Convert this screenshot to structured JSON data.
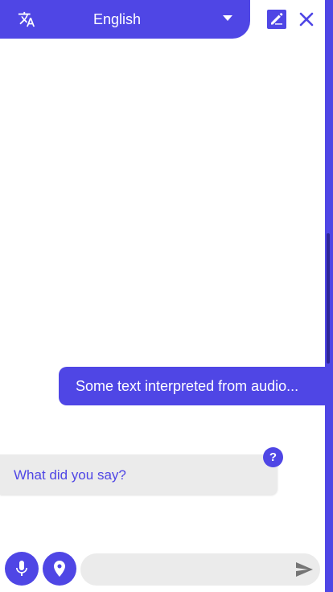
{
  "header": {
    "language_selected": "English",
    "icons": {
      "translate": "translate-icon",
      "caret": "chevron-down-icon",
      "edit": "edit-note-icon",
      "close": "close-icon"
    }
  },
  "messages": [
    {
      "from": "user",
      "text": "Some text interpreted from audio..."
    },
    {
      "from": "bot",
      "text": "What did you say?"
    }
  ],
  "help_badge": {
    "label": "?"
  },
  "composer": {
    "placeholder": "",
    "icons": {
      "mic": "microphone-icon",
      "location": "location-pin-icon",
      "send": "send-icon"
    }
  },
  "colors": {
    "accent": "#4f46e5",
    "bubble_bg": "#ebebeb",
    "scroll_thumb": "#2e2698"
  }
}
